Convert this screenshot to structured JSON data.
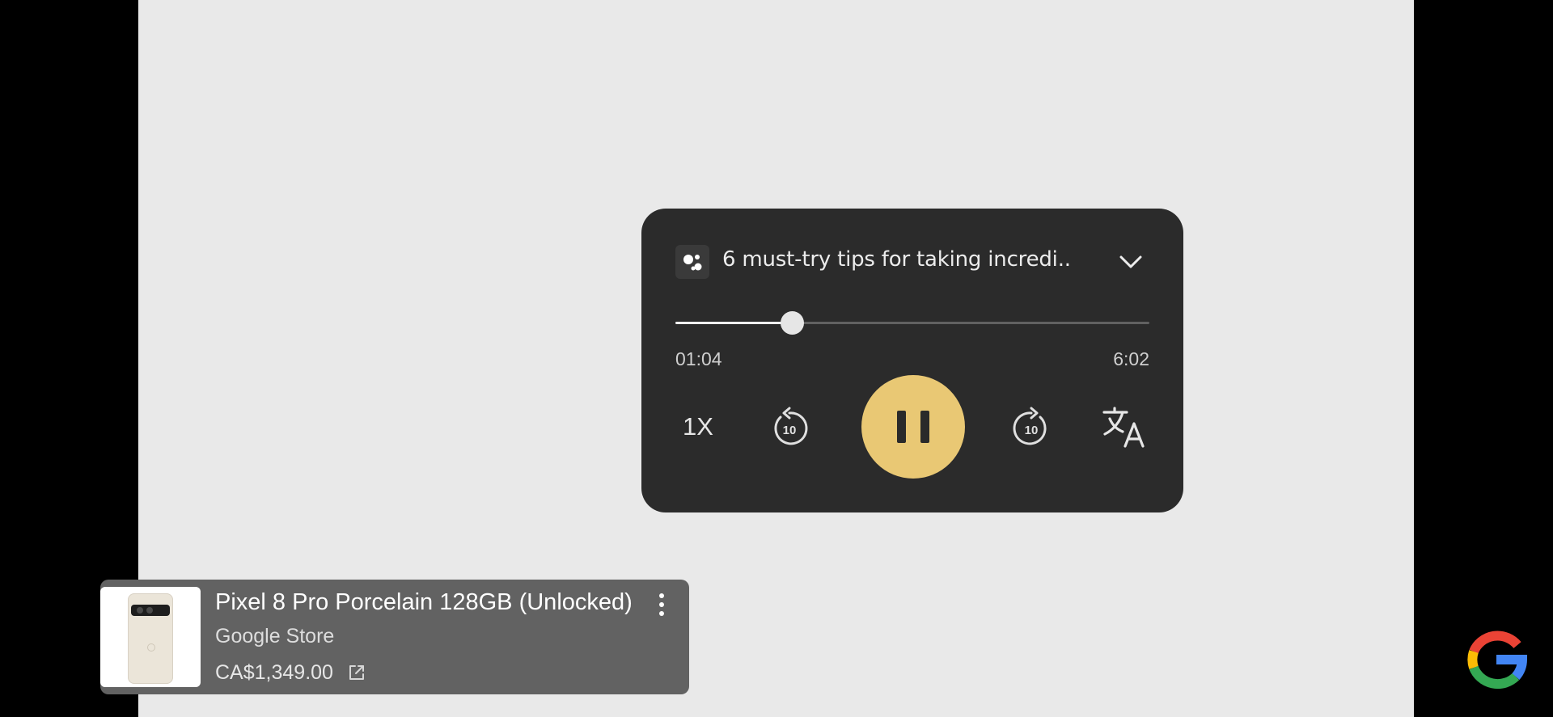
{
  "player": {
    "title": "6 must-try tips for taking incredi..",
    "progress_fraction": 0.246,
    "time_elapsed": "01:04",
    "time_total": "6:02",
    "speed_label": "1X",
    "rewind_seconds": "10",
    "forward_seconds": "10",
    "colors": {
      "card_background": "#2b2b2b",
      "pause_button": "#e9c874"
    }
  },
  "product_card": {
    "title": "Pixel 8 Pro Porcelain 128GB (Unlocked)",
    "store": "Google Store",
    "price": "CA$1,349.00"
  },
  "icons": {
    "assistant": "google-assistant-icon",
    "collapse": "chevron-down-icon",
    "rewind": "replay-10-icon",
    "play_state": "pause-icon",
    "forward": "forward-10-icon",
    "translate": "translate-icon",
    "more": "more-vert-icon",
    "open_external": "open-in-new-icon",
    "brand": "google-g-logo"
  }
}
